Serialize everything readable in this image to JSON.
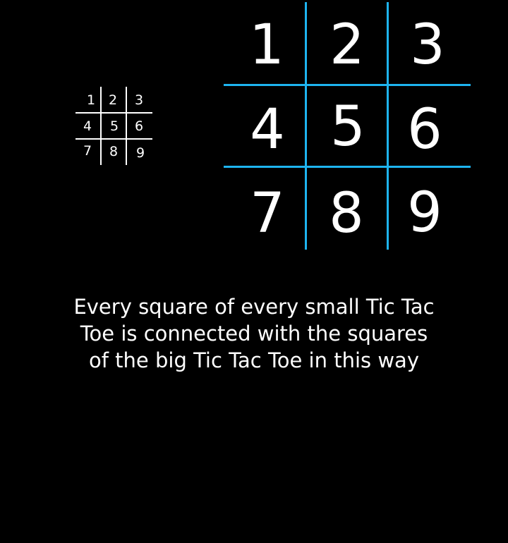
{
  "colors": {
    "background": "#000000",
    "text": "#ffffff",
    "small_grid_line": "#ffffff",
    "big_grid_line": "#1eb4f0"
  },
  "small_board": {
    "cells": [
      "1",
      "2",
      "3",
      "4",
      "5",
      "6",
      "7",
      "8",
      "9"
    ]
  },
  "big_board": {
    "cells": [
      "1",
      "2",
      "3",
      "4",
      "5",
      "6",
      "7",
      "8",
      "9"
    ]
  },
  "caption": "Every square of every small Tic Tac Toe is connected with the squares of the big Tic Tac Toe in this way"
}
